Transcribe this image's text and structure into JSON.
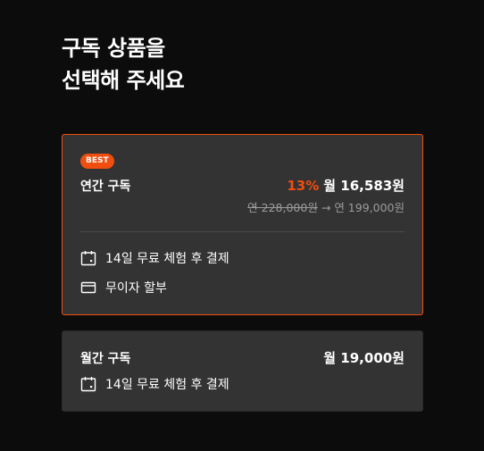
{
  "header": {
    "title_line1": "구독 상품을",
    "title_line2": "선택해 주세요"
  },
  "plans": [
    {
      "badge": "BEST",
      "name": "연간 구독",
      "discount": "13%",
      "price": "월 16,583원",
      "original_price": "연 228,000원",
      "arrow": "→",
      "discounted_price": "연 199,000원",
      "selected": true,
      "features": [
        {
          "icon": "calendar-icon",
          "label": "14일 무료 체험 후 결제"
        },
        {
          "icon": "credit-card-icon",
          "label": "무이자 할부"
        }
      ]
    },
    {
      "name": "월간 구독",
      "price": "월 19,000원",
      "selected": false,
      "features": [
        {
          "icon": "calendar-icon",
          "label": "14일 무료 체험 후 결제"
        }
      ]
    }
  ],
  "colors": {
    "background": "#0c0c0c",
    "card": "#333333",
    "accent": "#f04e0f",
    "muted": "#9b9b9b"
  }
}
